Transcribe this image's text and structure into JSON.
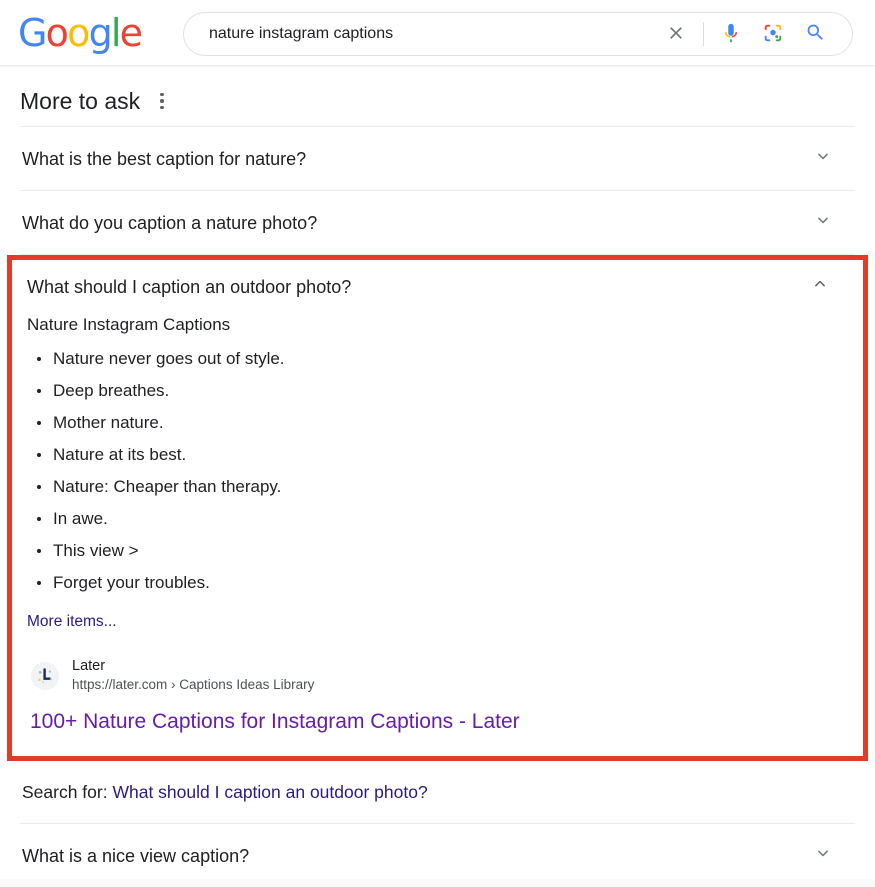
{
  "header": {
    "logo_text": "Google",
    "logo_letters": [
      {
        "ch": "G",
        "color": "#4285F4"
      },
      {
        "ch": "o",
        "color": "#EA4335"
      },
      {
        "ch": "o",
        "color": "#FBBC05"
      },
      {
        "ch": "g",
        "color": "#4285F4"
      },
      {
        "ch": "l",
        "color": "#34A853"
      },
      {
        "ch": "e",
        "color": "#EA4335"
      }
    ],
    "search": {
      "value": "nature instagram captions",
      "placeholder": "Search",
      "clear_icon": "close-icon",
      "voice_icon": "microphone-icon",
      "lens_icon": "google-lens-icon",
      "submit_icon": "search-icon"
    }
  },
  "paa": {
    "title": "More to ask",
    "menu_icon": "kebab-menu-icon",
    "questions": [
      {
        "text": "What is the best caption for nature?",
        "expanded": false,
        "chevron": "chevron-down-icon"
      },
      {
        "text": "What do you caption a nature photo?",
        "expanded": false,
        "chevron": "chevron-down-icon"
      },
      {
        "text": "What should I caption an outdoor photo?",
        "expanded": true,
        "chevron": "chevron-up-icon"
      },
      {
        "text": "What is a nice view caption?",
        "expanded": false,
        "chevron": "chevron-down-icon"
      }
    ]
  },
  "answer": {
    "subtitle": "Nature Instagram Captions",
    "bullets": [
      "Nature never goes out of style.",
      "Deep breathes.",
      "Mother nature.",
      "Nature at its best.",
      "Nature: Cheaper than therapy.",
      "In awe.",
      "This view >",
      "Forget your troubles."
    ],
    "more_items_label": "More items...",
    "source": {
      "favicon": "later-favicon",
      "name": "Later",
      "url": "https://later.com › Captions Ideas Library",
      "result_title": "100+ Nature Captions for Instagram Captions - Later"
    }
  },
  "search_for": {
    "prefix": "Search for: ",
    "link": "What should I caption an outdoor photo?"
  },
  "colors": {
    "highlight_box": "#e03c28",
    "link_visited": "#681da8",
    "link": "#2b1b7e",
    "text": "#202124"
  }
}
